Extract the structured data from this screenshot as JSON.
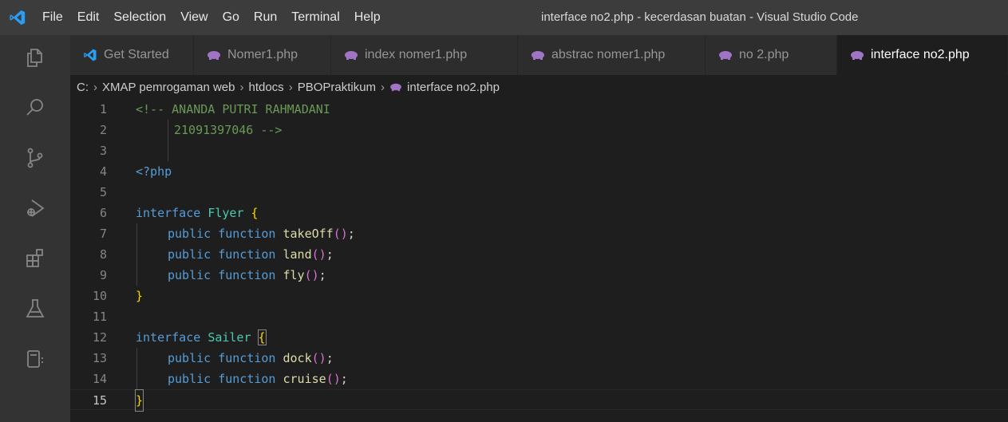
{
  "titlebar": {
    "menu": [
      "File",
      "Edit",
      "Selection",
      "View",
      "Go",
      "Run",
      "Terminal",
      "Help"
    ],
    "window_title": "interface no2.php - kecerdasan buatan - Visual Studio Code"
  },
  "activitybar": {
    "icons": [
      "explorer-icon",
      "search-icon",
      "source-control-icon",
      "run-debug-icon",
      "extensions-icon",
      "testing-icon",
      "remote-explorer-icon"
    ]
  },
  "tabs": [
    {
      "label": "Get Started",
      "icon": "vscode-icon",
      "active": false
    },
    {
      "label": "Nomer1.php",
      "icon": "php-elephant-icon",
      "active": false
    },
    {
      "label": "index nomer1.php",
      "icon": "php-elephant-icon",
      "active": false
    },
    {
      "label": "abstrac nomer1.php",
      "icon": "php-elephant-icon",
      "active": false
    },
    {
      "label": "no 2.php",
      "icon": "php-elephant-icon",
      "active": false
    },
    {
      "label": "interface no2.php",
      "icon": "php-elephant-icon",
      "active": true
    }
  ],
  "breadcrumb": [
    "C:",
    "XMAP pemrogaman web",
    "htdocs",
    "PBOPraktikum",
    "interface no2.php"
  ],
  "editor": {
    "current_line": 15,
    "lines": [
      {
        "n": "1",
        "text": "<!-- ANANDA PUTRI RAHMADANI"
      },
      {
        "n": "2",
        "text": "21091397046 -->"
      },
      {
        "n": "3",
        "text": ""
      },
      {
        "n": "4",
        "text": "<?php"
      },
      {
        "n": "5",
        "text": ""
      },
      {
        "n": "6",
        "text": "interface Flyer {"
      },
      {
        "n": "7",
        "text": "public function takeOff();"
      },
      {
        "n": "8",
        "text": "public function land();"
      },
      {
        "n": "9",
        "text": "public function fly();"
      },
      {
        "n": "10",
        "text": "}"
      },
      {
        "n": "11",
        "text": ""
      },
      {
        "n": "12",
        "text": "interface Sailer {"
      },
      {
        "n": "13",
        "text": "public function dock();"
      },
      {
        "n": "14",
        "text": "public function cruise();"
      },
      {
        "n": "15",
        "text": "}"
      }
    ]
  },
  "colors": {
    "accent": "#007acc",
    "titlebar": "#3c3c3c",
    "activitybar": "#333333",
    "editor_bg": "#1e1e1e",
    "php_icon": "#a074c4"
  }
}
